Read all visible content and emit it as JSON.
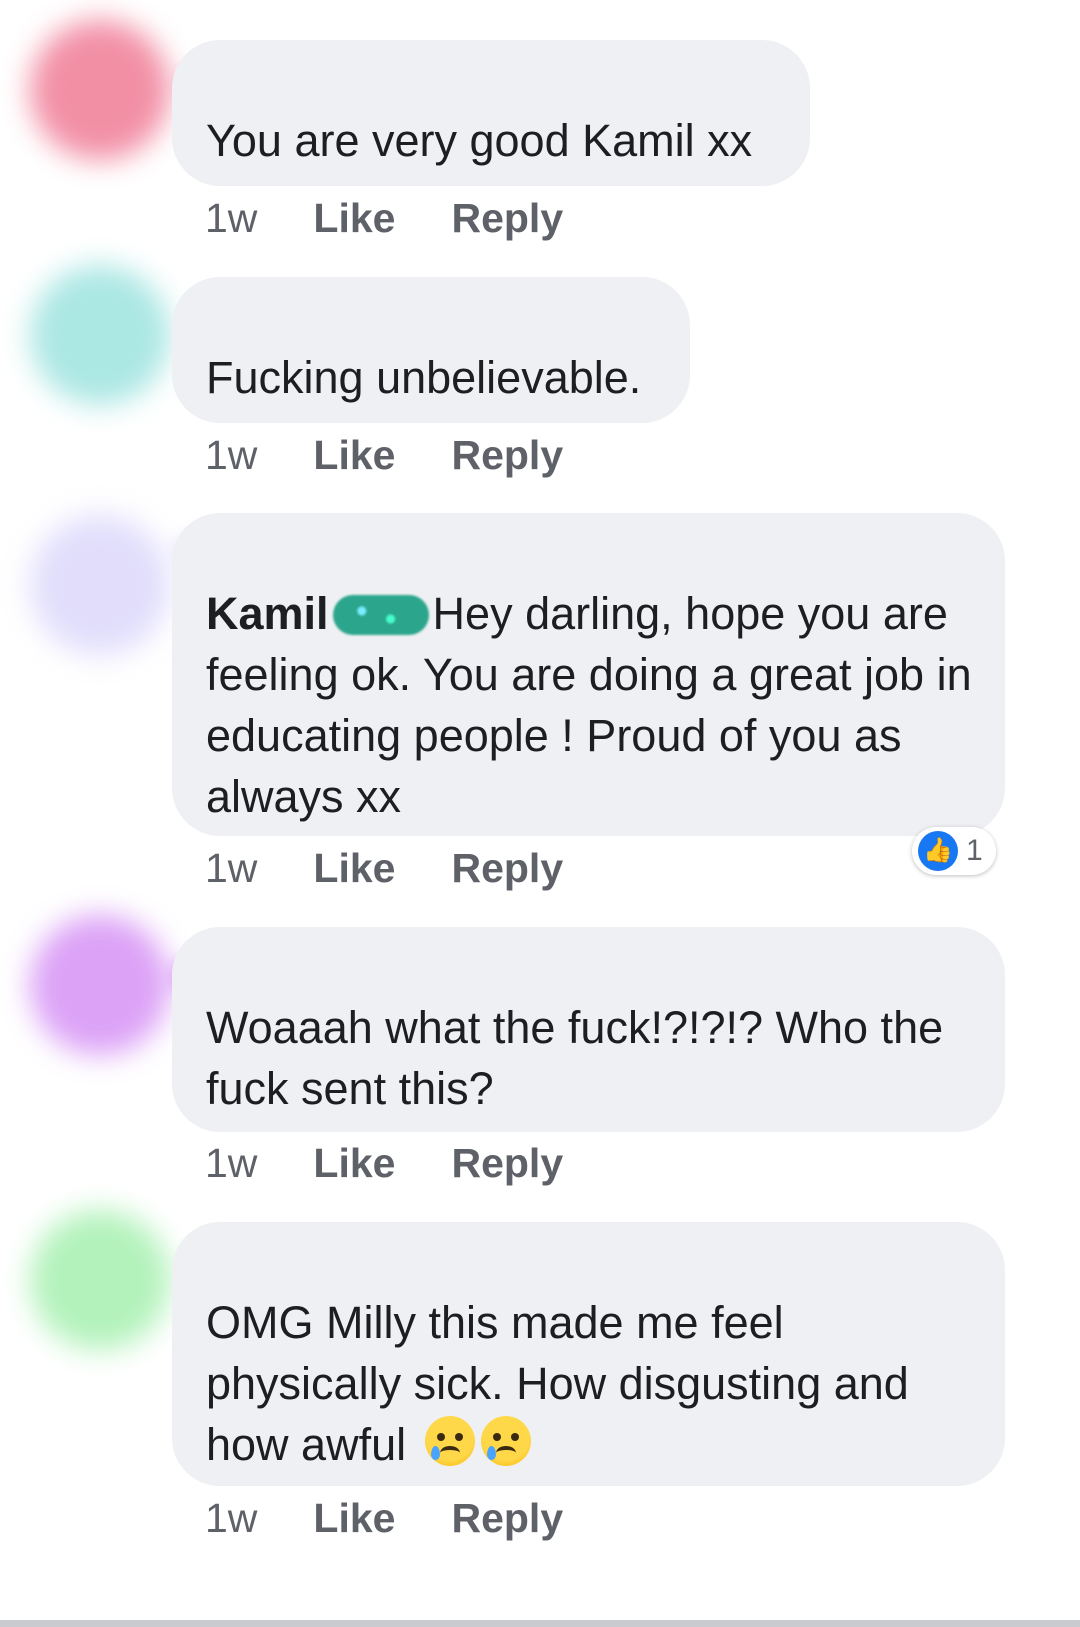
{
  "comments": [
    {
      "avatar_color": "#f07c96",
      "text": "You are very good Kamil xx",
      "time": "1w",
      "like_label": "Like",
      "reply_label": "Reply"
    },
    {
      "avatar_color": "#9de3df",
      "text": "Fucking unbelievable.",
      "time": "1w",
      "like_label": "Like",
      "reply_label": "Reply"
    },
    {
      "avatar_color": "#dcd8fb",
      "mention": "Kamil",
      "text": "Hey darling, hope you are feeling ok. You are doing a great job in educating people ! Proud of you as always xx",
      "time": "1w",
      "like_label": "Like",
      "reply_label": "Reply",
      "reaction_count": "1"
    },
    {
      "avatar_color": "#d692f5",
      "text": "Woaaah what the fuck!?!?!? Who the fuck sent this?",
      "time": "1w",
      "like_label": "Like",
      "reply_label": "Reply"
    },
    {
      "avatar_color": "#a6f0b0",
      "text": "OMG Milly this made me feel physically sick. How disgusting and how awful",
      "time": "1w",
      "like_label": "Like",
      "reply_label": "Reply",
      "emoji": "crying-face-icon"
    }
  ]
}
